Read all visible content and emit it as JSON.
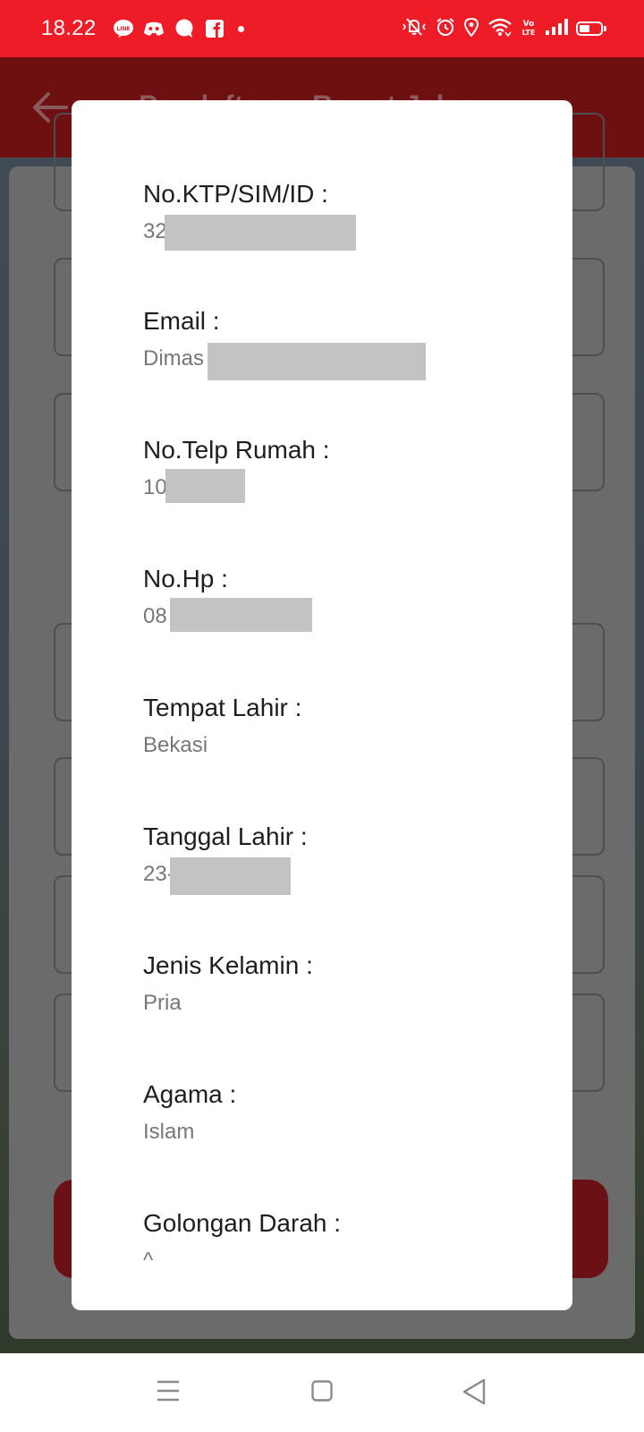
{
  "status_bar": {
    "time": "18.22",
    "app_icons": [
      "line-icon",
      "discord-icon",
      "chat-bubble-icon",
      "facebook-icon"
    ],
    "system_icons": [
      "vibrate-off-icon",
      "alarm-icon",
      "location-icon",
      "wifi-icon",
      "volte-icon",
      "signal-icon",
      "battery-icon"
    ],
    "volte_label": "Vo\nLTE",
    "battery_level": 0.5,
    "color": "#ee1c27"
  },
  "header": {
    "title": "Pendaftaran Rawat Jalan",
    "color": "#6e0f12"
  },
  "modal": {
    "fields": [
      {
        "label": "No.KTP/SIM/ID :",
        "value": "32"
      },
      {
        "label": "Email :",
        "value": "Dimas"
      },
      {
        "label": "No.Telp Rumah :",
        "value": "10"
      },
      {
        "label": "No.Hp :",
        "value": "08"
      },
      {
        "label": "Tempat Lahir :",
        "value": "Bekasi"
      },
      {
        "label": "Tanggal Lahir :",
        "value": "23-"
      },
      {
        "label": "Jenis Kelamin :",
        "value": "Pria"
      },
      {
        "label": "Agama :",
        "value": "Islam"
      },
      {
        "label": "Golongan Darah :",
        "value": "^"
      }
    ]
  },
  "nav_bar": {
    "icons": [
      "menu-icon",
      "home-square-icon",
      "back-triangle-icon"
    ]
  }
}
